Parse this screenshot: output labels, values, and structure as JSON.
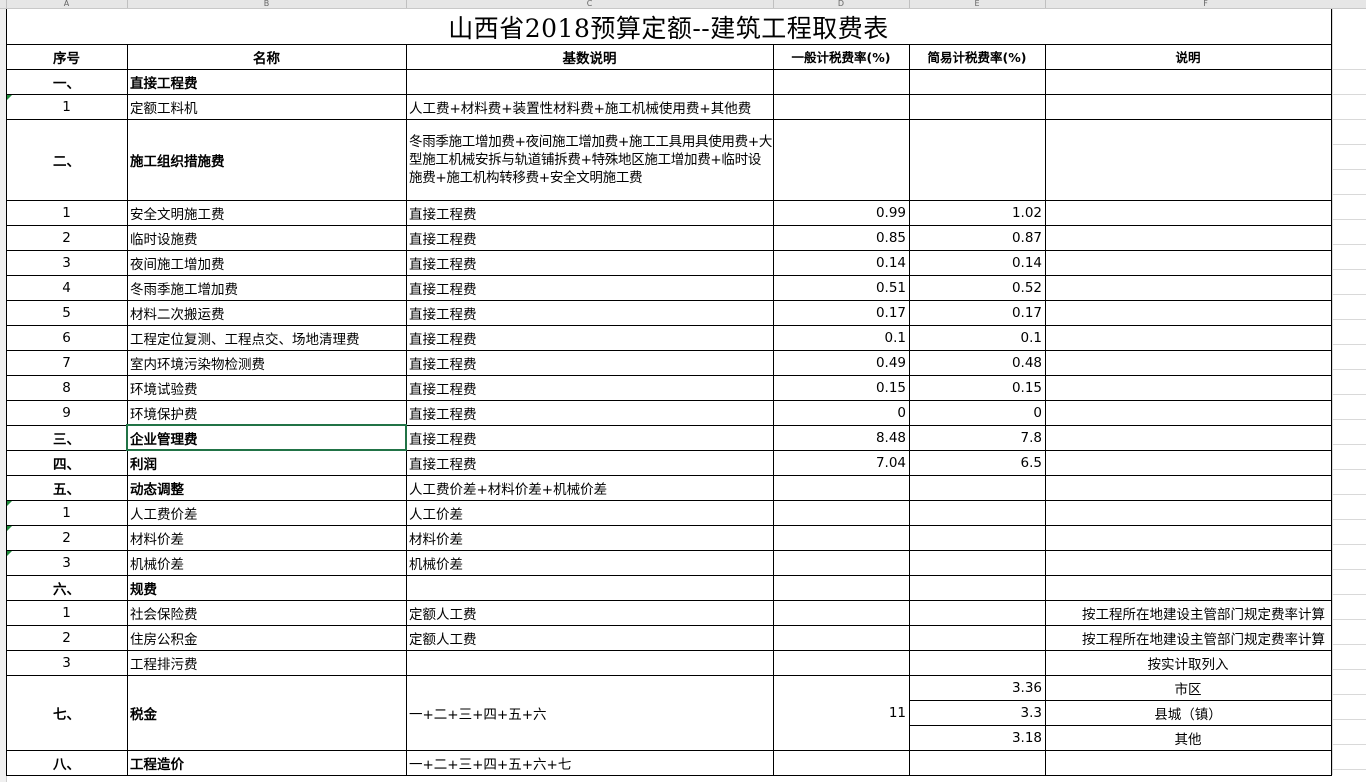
{
  "sheet": {
    "column_letters": [
      "A",
      "B",
      "C",
      "D",
      "E",
      "F"
    ],
    "title": "山西省2018预算定额--建筑工程取费表",
    "headers": [
      "序号",
      "名称",
      "基数说明",
      "一般计税费率(%)",
      "简易计税费率(%)",
      "说明"
    ],
    "rows": [
      {
        "no": "一、",
        "name": "直接工程费",
        "base": "",
        "general": "",
        "simple": "",
        "note": "",
        "bold": true
      },
      {
        "no": "1",
        "name": "定额工料机",
        "base": "人工费+材料费+装置性材料费+施工机械使用费+其他费",
        "general": "",
        "simple": "",
        "note": "",
        "bold": false
      },
      {
        "no": "二、",
        "name": "施工组织措施费",
        "base": "冬雨季施工增加费+夜间施工增加费+施工工具用具使用费+大型施工机械安拆与轨道铺拆费+特殊地区施工增加费+临时设施费+施工机构转移费+安全文明施工费",
        "general": "",
        "simple": "",
        "note": "",
        "bold": true
      },
      {
        "no": "1",
        "name": "安全文明施工费",
        "base": "直接工程费",
        "general": "0.99",
        "simple": "1.02",
        "note": "",
        "bold": false
      },
      {
        "no": "2",
        "name": "临时设施费",
        "base": "直接工程费",
        "general": "0.85",
        "simple": "0.87",
        "note": "",
        "bold": false
      },
      {
        "no": "3",
        "name": "夜间施工增加费",
        "base": "直接工程费",
        "general": "0.14",
        "simple": "0.14",
        "note": "",
        "bold": false
      },
      {
        "no": "4",
        "name": "冬雨季施工增加费",
        "base": "直接工程费",
        "general": "0.51",
        "simple": "0.52",
        "note": "",
        "bold": false
      },
      {
        "no": "5",
        "name": "材料二次搬运费",
        "base": "直接工程费",
        "general": "0.17",
        "simple": "0.17",
        "note": "",
        "bold": false
      },
      {
        "no": "6",
        "name": "工程定位复测、工程点交、场地清理费",
        "base": "直接工程费",
        "general": "0.1",
        "simple": "0.1",
        "note": "",
        "bold": false
      },
      {
        "no": "7",
        "name": "室内环境污染物检测费",
        "base": "直接工程费",
        "general": "0.49",
        "simple": "0.48",
        "note": "",
        "bold": false
      },
      {
        "no": "8",
        "name": "环境试验费",
        "base": "直接工程费",
        "general": "0.15",
        "simple": "0.15",
        "note": "",
        "bold": false
      },
      {
        "no": "9",
        "name": "环境保护费",
        "base": "直接工程费",
        "general": "0",
        "simple": "0",
        "note": "",
        "bold": false
      },
      {
        "no": "三、",
        "name": "企业管理费",
        "base": "直接工程费",
        "general": "8.48",
        "simple": "7.8",
        "note": "",
        "bold": true
      },
      {
        "no": "四、",
        "name": "利润",
        "base": "直接工程费",
        "general": "7.04",
        "simple": "6.5",
        "note": "",
        "bold": true
      },
      {
        "no": "五、",
        "name": "动态调整",
        "base": "人工费价差+材料价差+机械价差",
        "general": "",
        "simple": "",
        "note": "",
        "bold": true
      },
      {
        "no": "1",
        "name": "人工费价差",
        "base": "人工价差",
        "general": "",
        "simple": "",
        "note": "",
        "bold": false
      },
      {
        "no": "2",
        "name": "材料价差",
        "base": "材料价差",
        "general": "",
        "simple": "",
        "note": "",
        "bold": false
      },
      {
        "no": "3",
        "name": "机械价差",
        "base": "机械价差",
        "general": "",
        "simple": "",
        "note": "",
        "bold": false
      },
      {
        "no": "六、",
        "name": "规费",
        "base": "",
        "general": "",
        "simple": "",
        "note": "",
        "bold": true
      },
      {
        "no": "1",
        "name": "社会保险费",
        "base": "定额人工费",
        "general": "",
        "simple": "",
        "note": "按工程所在地建设主管部门规定费率计算",
        "bold": false
      },
      {
        "no": "2",
        "name": "住房公积金",
        "base": "定额人工费",
        "general": "",
        "simple": "",
        "note": "按工程所在地建设主管部门规定费率计算",
        "bold": false
      },
      {
        "no": "3",
        "name": "工程排污费",
        "base": "",
        "general": "",
        "simple": "",
        "note": "按实计取列入",
        "bold": false
      }
    ],
    "tax": {
      "no": "七、",
      "name": "税金",
      "base": "一+二+三+四+五+六",
      "general": "11",
      "simple": [
        "3.36",
        "3.3",
        "3.18"
      ],
      "note": [
        "市区",
        "县城（镇）",
        "其他"
      ]
    },
    "total": {
      "no": "八、",
      "name": "工程造价",
      "base": "一+二+三+四+五+六+七"
    }
  }
}
